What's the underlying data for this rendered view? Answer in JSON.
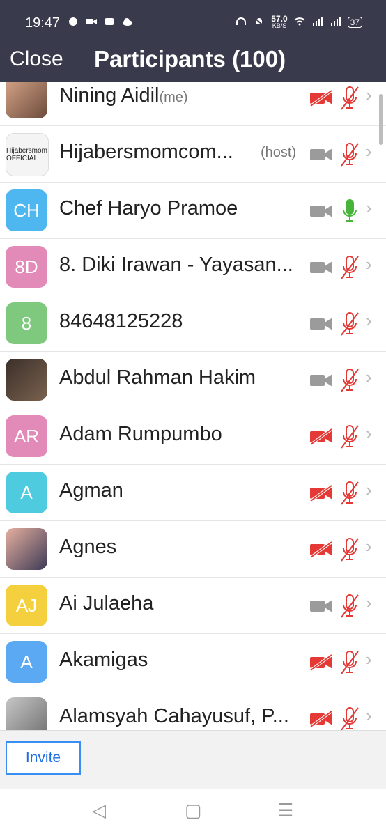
{
  "status_bar": {
    "time": "19:47",
    "speed": "57.0",
    "speed_unit": "KB/S",
    "battery": "37",
    "icons_left": [
      "whatsapp-icon",
      "video-icon",
      "messenger-icon",
      "cloud-icon"
    ],
    "icons_right": [
      "headphones-icon",
      "mute-bell-icon",
      "wifi-icon",
      "signal-icon",
      "battery-icon"
    ]
  },
  "header": {
    "close_label": "Close",
    "title": "Participants (100)"
  },
  "participants": [
    {
      "name": "Nining Aidil",
      "tag": "(me)",
      "avatar": "photo",
      "video": "off",
      "mic": "off"
    },
    {
      "name": "Hijabersmomcom...",
      "tag": "(host)",
      "avatar": "logo",
      "logo_text": "Hijabersmom OFFICIAL",
      "video": "on",
      "mic": "off"
    },
    {
      "name": "Chef Haryo Pramoe",
      "avatar_text": "CH",
      "avatar_color": "#4fb7f0",
      "video": "on",
      "mic": "on"
    },
    {
      "name": "8. Diki Irawan - Yayasan...",
      "avatar_text": "8D",
      "avatar_color": "#e38bb8",
      "video": "on",
      "mic": "off"
    },
    {
      "name": "84648125228",
      "avatar_text": "8",
      "avatar_color": "#7fc97f",
      "video": "on",
      "mic": "off"
    },
    {
      "name": "Abdul Rahman Hakim",
      "avatar": "photo2",
      "video": "on",
      "mic": "off"
    },
    {
      "name": "Adam Rumpumbo",
      "avatar_text": "AR",
      "avatar_color": "#e38bb8",
      "video": "off",
      "mic": "off"
    },
    {
      "name": "Agman",
      "avatar_text": "A",
      "avatar_color": "#4fcbe0",
      "video": "off",
      "mic": "off"
    },
    {
      "name": "Agnes",
      "avatar": "photo3",
      "video": "off",
      "mic": "off"
    },
    {
      "name": "Ai Julaeha",
      "avatar_text": "AJ",
      "avatar_color": "#f4d03f",
      "video": "on",
      "mic": "off"
    },
    {
      "name": "Akamigas",
      "avatar_text": "A",
      "avatar_color": "#5aa9f2",
      "video": "off",
      "mic": "off"
    },
    {
      "name": "Alamsyah Cahayusuf, P...",
      "avatar": "photo4",
      "video": "off",
      "mic": "off"
    }
  ],
  "bottom": {
    "invite_label": "Invite"
  },
  "nav": {
    "back": "◁",
    "home": "▢",
    "menu": "☰"
  },
  "colors": {
    "header": "#3a3a4d",
    "red": "#e53935",
    "green": "#47b53a",
    "gray": "#9b9b9b",
    "invite": "#1e6ee6"
  }
}
